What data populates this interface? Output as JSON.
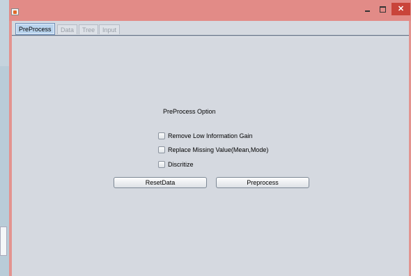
{
  "window": {
    "icon": "java-cup-icon",
    "controls": {
      "minimize": "minimize-icon",
      "maximize": "maximize-icon",
      "close_symbol": "✕"
    }
  },
  "tabs": [
    {
      "label": "PreProcess",
      "active": true
    },
    {
      "label": "Data",
      "active": false
    },
    {
      "label": "Tree",
      "active": false
    },
    {
      "label": "Input",
      "active": false
    }
  ],
  "panel": {
    "title": "PreProcess Option",
    "options": [
      {
        "label": "Remove Low Information Gain",
        "checked": false
      },
      {
        "label": "Replace Missing Value(Mean,Mode)",
        "checked": false
      },
      {
        "label": "Discritize",
        "checked": false
      }
    ],
    "buttons": {
      "reset": "ResetData",
      "preprocess": "Preprocess"
    }
  },
  "colors": {
    "titlebar": "#e28b87",
    "close_button": "#c9443a",
    "panel_bg": "#d5d9e0",
    "active_tab": "#b9d4ee"
  }
}
